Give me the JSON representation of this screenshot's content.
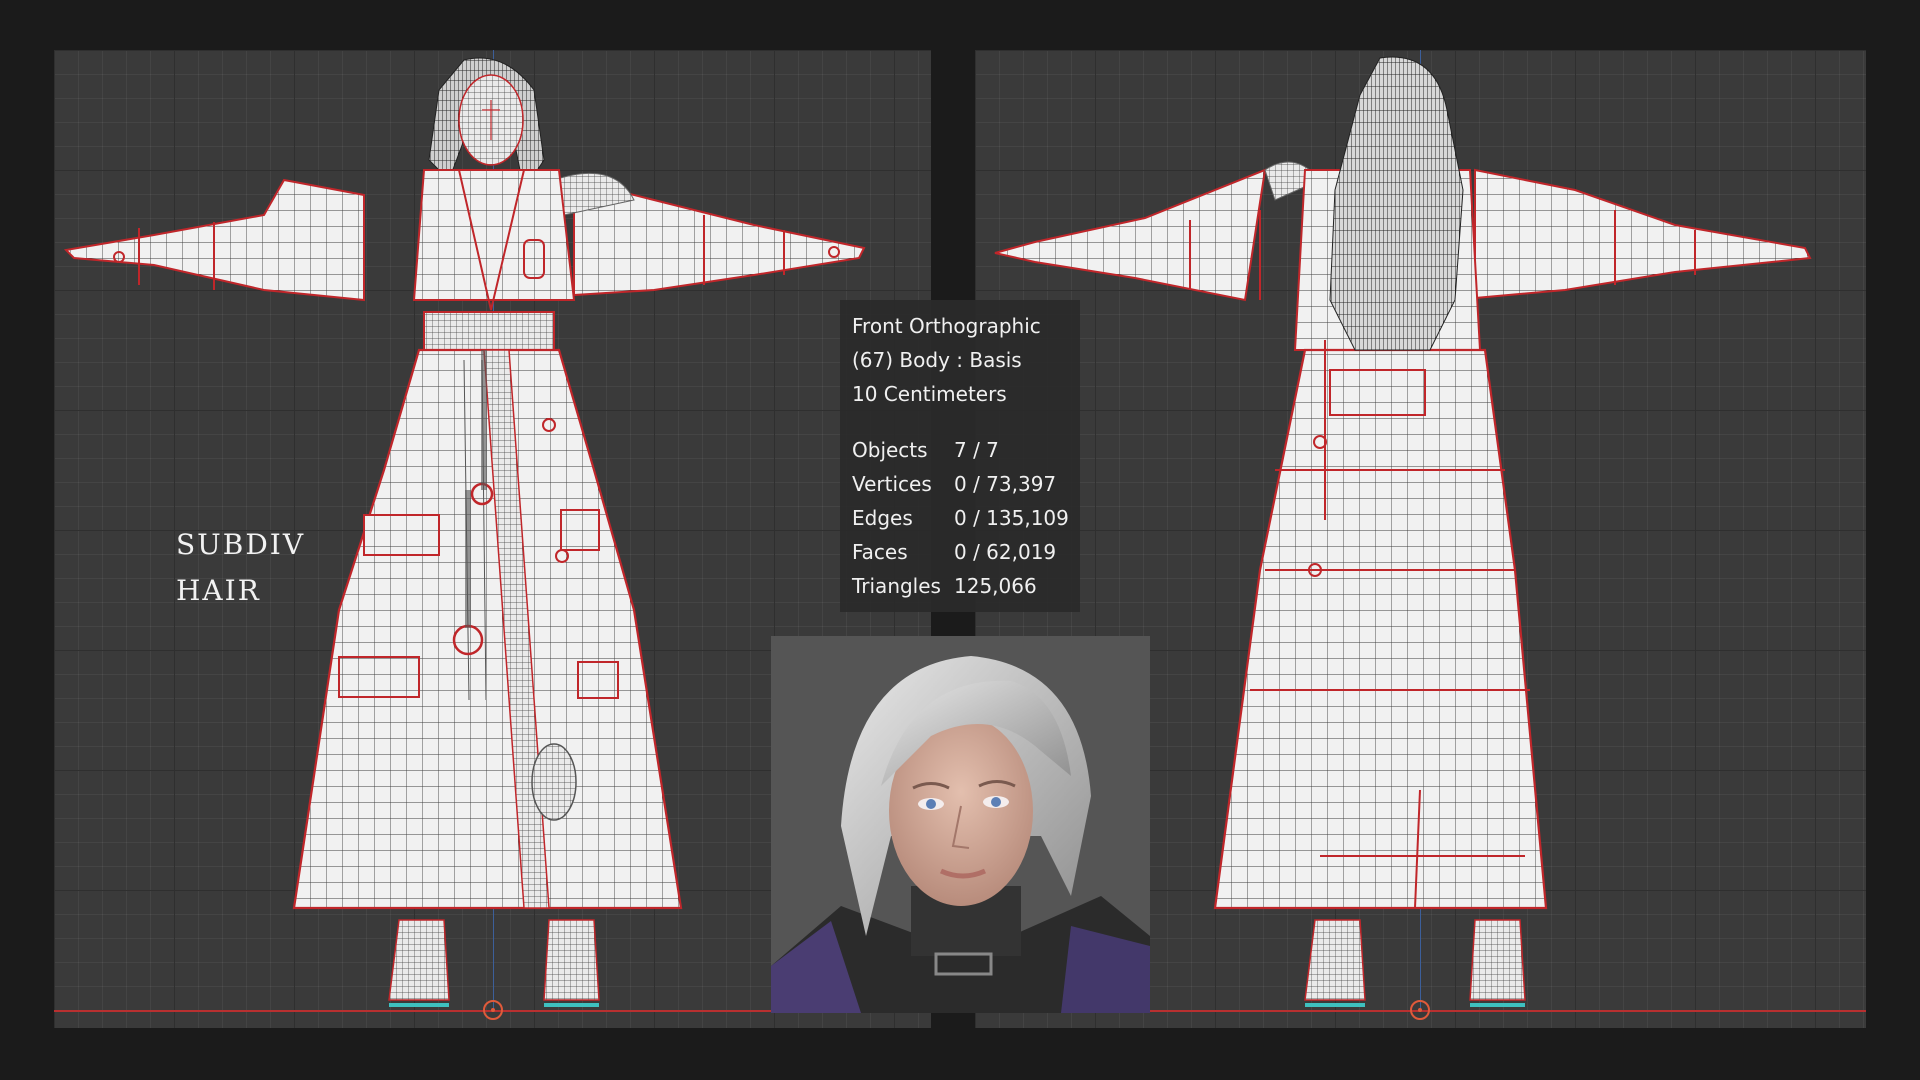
{
  "overlay_label": {
    "line1": "Subdiv",
    "line2": "Hair"
  },
  "viewport_info": {
    "view_name": "Front Orthographic",
    "object_info": "(67) Body : Basis",
    "scale_info": "10 Centimeters"
  },
  "statistics": [
    {
      "label": "Objects",
      "value": "7 / 7"
    },
    {
      "label": "Vertices",
      "value": "0 / 73,397"
    },
    {
      "label": "Edges",
      "value": "0 / 135,109"
    },
    {
      "label": "Faces",
      "value": "0 / 62,019"
    },
    {
      "label": "Triangles",
      "value": "125,066"
    }
  ],
  "colors": {
    "viewport_bg": "#3a3a3a",
    "grid": "#2f2f2f",
    "seam_red": "#c0262a",
    "wire_dark": "#3c3c3c",
    "mesh_fill": "#f1f1f1",
    "floor_axis": "#b83030",
    "z_axis": "#3c5f9a"
  }
}
